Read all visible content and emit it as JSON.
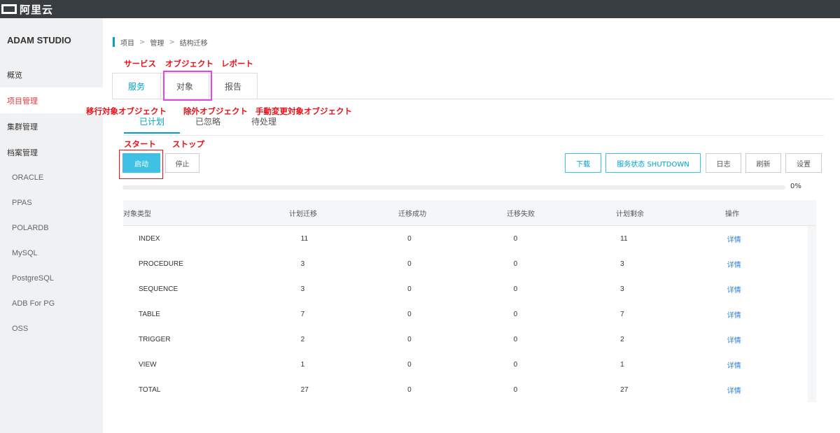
{
  "brand": {
    "logo_text": "阿里云",
    "studio_title": "ADAM STUDIO"
  },
  "sidebar": {
    "items": [
      {
        "label": "概览"
      },
      {
        "label": "项目管理"
      },
      {
        "label": "集群管理"
      },
      {
        "label": "档案管理"
      }
    ],
    "sub_items": [
      {
        "label": "ORACLE"
      },
      {
        "label": "PPAS"
      },
      {
        "label": "POLARDB"
      },
      {
        "label": "MySQL"
      },
      {
        "label": "PostgreSQL"
      },
      {
        "label": "ADB For PG"
      },
      {
        "label": "OSS"
      }
    ]
  },
  "breadcrumb": [
    "项目",
    "管理",
    "结构迁移"
  ],
  "breadcrumb_sep": ">",
  "annotations": {
    "tabs": [
      "サービス",
      "オブジェクト",
      "レポート"
    ],
    "subtabs": [
      "移行対象オブジェクト",
      "除外オブジェクト",
      "手動変更対象オブジェクト"
    ],
    "actions": [
      "スタート",
      "ストップ"
    ]
  },
  "tabs": [
    {
      "label": "服务"
    },
    {
      "label": "对象"
    },
    {
      "label": "报告"
    }
  ],
  "subtabs": [
    {
      "label": "已计划"
    },
    {
      "label": "已忽略"
    },
    {
      "label": "待处理"
    }
  ],
  "actions": {
    "start": "启动",
    "stop": "停止",
    "download": "下载",
    "service_status": "服务状态 SHUTDOWN",
    "log": "日志",
    "refresh": "刷新",
    "settings": "设置"
  },
  "progress": {
    "value": 0,
    "label": "0%"
  },
  "colors": {
    "accent": "#00a2ca",
    "primary_button": "#3fc0e5",
    "annotation_red": "#e8131a",
    "highlight_magenta": "#e645e6",
    "topbar": "#373d41"
  },
  "table": {
    "headers": [
      "对象类型",
      "计划迁移",
      "迁移成功",
      "迁移失败",
      "计划剩余",
      "操作"
    ],
    "rows": [
      [
        "INDEX",
        "11",
        "0",
        "0",
        "11",
        "详情"
      ],
      [
        "PROCEDURE",
        "3",
        "0",
        "0",
        "3",
        "详情"
      ],
      [
        "SEQUENCE",
        "3",
        "0",
        "0",
        "3",
        "详情"
      ],
      [
        "TABLE",
        "7",
        "0",
        "0",
        "7",
        "详情"
      ],
      [
        "TRIGGER",
        "2",
        "0",
        "0",
        "2",
        "详情"
      ],
      [
        "VIEW",
        "1",
        "0",
        "0",
        "1",
        "详情"
      ],
      [
        "TOTAL",
        "27",
        "0",
        "0",
        "27",
        "详情"
      ]
    ]
  }
}
